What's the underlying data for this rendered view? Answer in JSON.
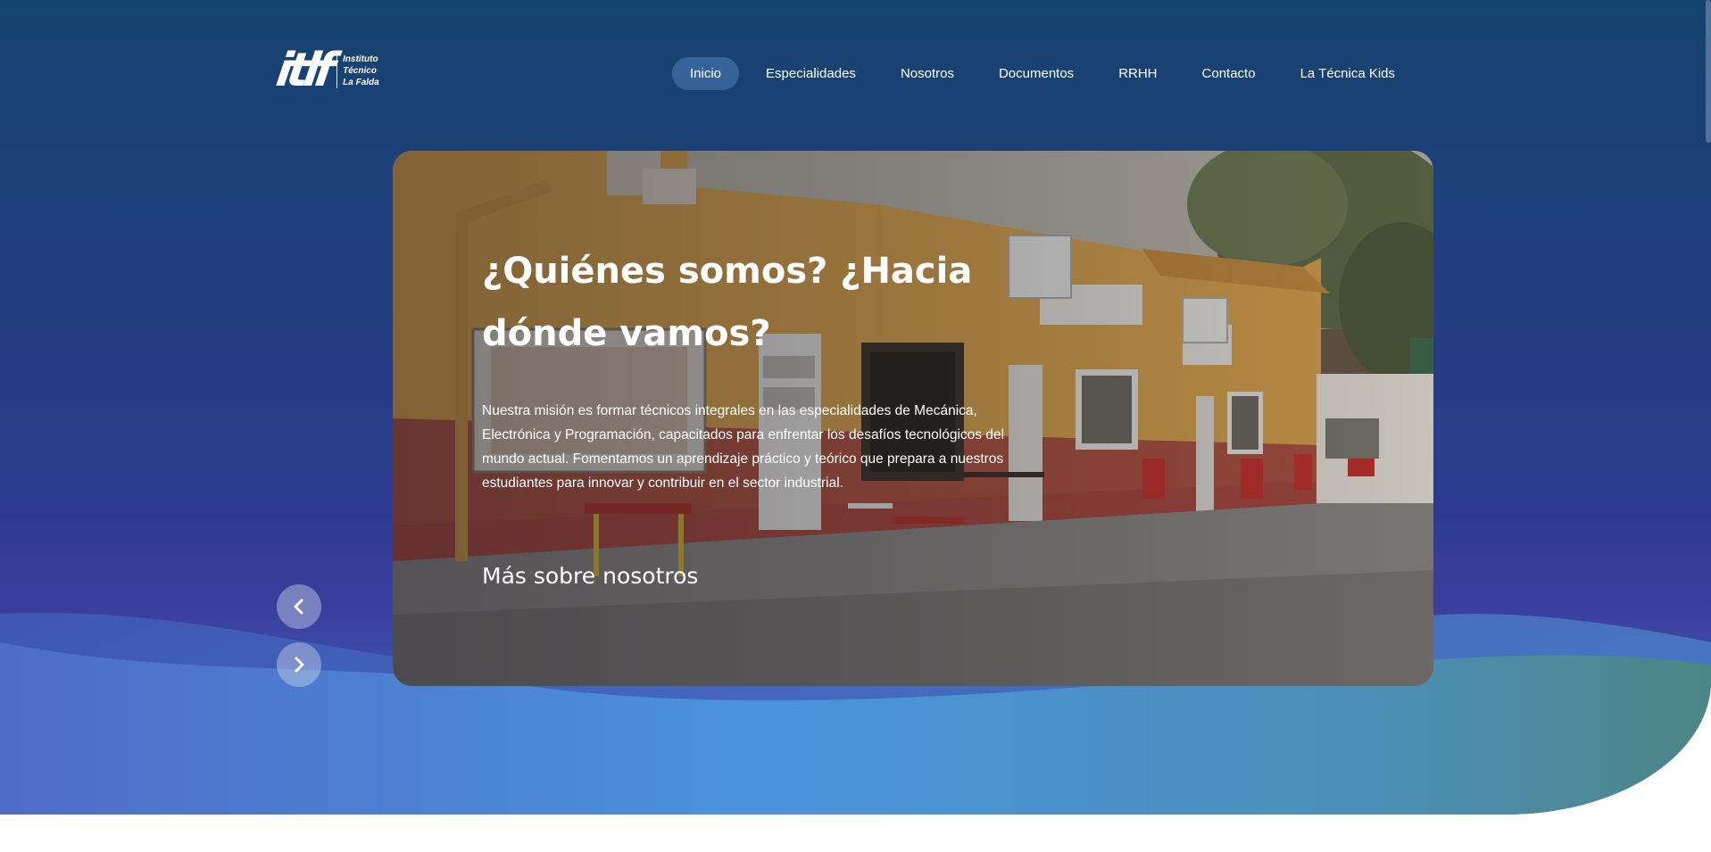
{
  "logo": {
    "mark": "itlf",
    "lines": [
      "Instituto",
      "Técnico",
      "La Falda"
    ]
  },
  "nav": {
    "items": [
      {
        "label": "Inicio",
        "active": true
      },
      {
        "label": "Especialidades",
        "active": false
      },
      {
        "label": "Nosotros",
        "active": false
      },
      {
        "label": "Documentos",
        "active": false
      },
      {
        "label": "RRHH",
        "active": false
      },
      {
        "label": "Contacto",
        "active": false
      },
      {
        "label": "La Técnica Kids",
        "active": false
      }
    ]
  },
  "hero": {
    "title": "¿Quiénes somos? ¿Hacia dónde vamos?",
    "text": "Nuestra misión es formar técnicos integrales en las especialidades de Mecánica, Electrónica y Programación, capacitados para enfrentar los desafíos tecnológicos del mundo actual. Fomentamos un aprendizaje práctico y teórico que prepara a nuestros estudiantes para innovar y contribuir en el sector industrial.",
    "link_label": "Más sobre nosotros"
  },
  "carousel": {
    "prev_icon": "chevron-left-icon",
    "next_icon": "chevron-right-icon"
  },
  "colors": {
    "header_top": "#15436f",
    "header_mid": "#2d3a8f",
    "wave_light": "#4a8fd9",
    "wave_teal": "#4c8a8c",
    "building_wall": "#d9a64a",
    "building_base": "#a8463c",
    "nav_active_bg": "#5a8cc8"
  }
}
